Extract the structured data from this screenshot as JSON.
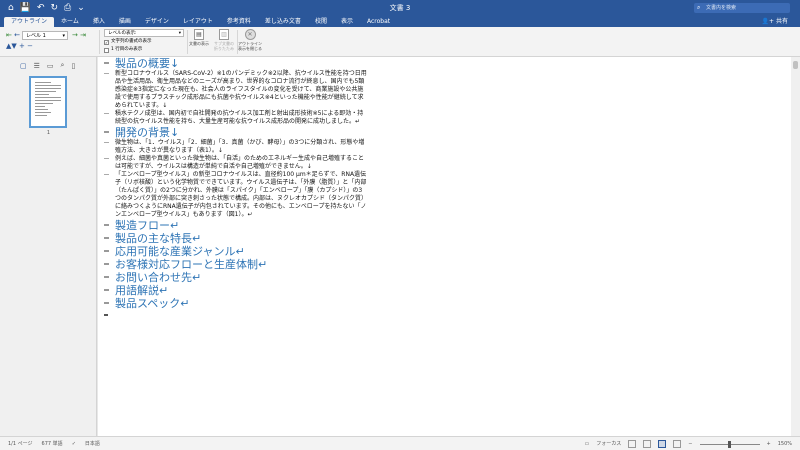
{
  "window": {
    "title": "文書 3"
  },
  "quick_access": {
    "home": "⌂",
    "save": "💾",
    "undo": "↶",
    "redo": "↻",
    "print": "⎙",
    "more": "⌄"
  },
  "search": {
    "placeholder": "文書内を検索"
  },
  "tabs": [
    "アウトライン",
    "ホーム",
    "挿入",
    "描画",
    "デザイン",
    "レイアウト",
    "参考資料",
    "差し込み文書",
    "校閲",
    "表示",
    "Acrobat"
  ],
  "share_label": "共有",
  "ribbon": {
    "level_value": "レベル 1",
    "show_level_value": "レベルの表示:",
    "show_formatting_label": "文字列の書式の表示",
    "first_line_only_label": "1 行目のみ表示",
    "show_document_label": "文書の表示",
    "collapse_subdocs_label": "サブ文書の折りたたみ",
    "close_outline_label": "アウトライン表示を閉じる"
  },
  "sidepane": {
    "page_number": "1"
  },
  "document": {
    "sections": [
      {
        "heading": "製品の概要↓",
        "paragraphs": [
          "新型コロナウイルス（SARS-CoV-2）※1のパンデミック※2以降、抗ウイルス性能を持つ日用品や生活用品、衛生用品などのニーズが高まり、世界的なコロナ流行が終息し、国内でも5類感染症※3指定になった現在も、社会人のライフスタイルの変化を受けて、商業施設や公共施設で使用するプラスチック成形品にも抗菌や抗ウイルス※4といった機能や性能が継続して求められています。↓",
          "積水テクノ成型は、国内初で自社開発の抗ウイルス加工剤と射出成形技術※5による即効・持続型の抗ウイルス性能を持ち、大量生産可能な抗ウイルス成形品の開発に成功しました。↵"
        ]
      },
      {
        "heading": "開発の背景↓",
        "paragraphs": [
          "微生物は、「1．ウイルス」「2．細菌」「3．真菌（かび、酵母）」の3つに分類され、形態や増殖方法、大きさが異なります（表1）。↓",
          "例えば、細菌や真菌といった微生物は、「自活」のためのエネルギー生成や自己増殖することは可能ですが、ウイルスは構造が単純で自活や自己増殖ができません。↓",
          "「エンベロープ型ウイルス」の新型コロナウイルスは、直径約100 μm＊足らずで、RNA遺伝子（リボ核酸）という化学物質でできています。ウイルス遺伝子は、「外膜（脂質）」と「内部（たんぱく質）」の2つに分かれ、外膜は「スパイク」「エンベロープ」「膜（カプシド）」の3つのタンパク質が外部に突き刺さった状態で構成。内部は、ヌクレオカプシド（タンパク質）に絡みつくようにRNA遺伝子が内包されています。その他にも、エンベロープを持たない「ノンエンベロープ型ウイルス」もあります（図1）。↵"
        ]
      },
      {
        "heading": "製造フロー↵",
        "paragraphs": []
      },
      {
        "heading": "製品の主な特長↵",
        "paragraphs": []
      },
      {
        "heading": "応用可能な産業ジャンル↵",
        "paragraphs": []
      },
      {
        "heading": "お客様対応フローと生産体制↵",
        "paragraphs": []
      },
      {
        "heading": "お問い合わせ先↵",
        "paragraphs": []
      },
      {
        "heading": "用語解説↵",
        "paragraphs": []
      },
      {
        "heading": "製品スペック↵",
        "paragraphs": []
      }
    ]
  },
  "status": {
    "page": "1/1 ページ",
    "words": "677 単語",
    "language": "日本語",
    "focus": "フォーカス",
    "zoom": "150%"
  },
  "colors": {
    "brand": "#2b579a",
    "heading": "#2e74b5"
  }
}
